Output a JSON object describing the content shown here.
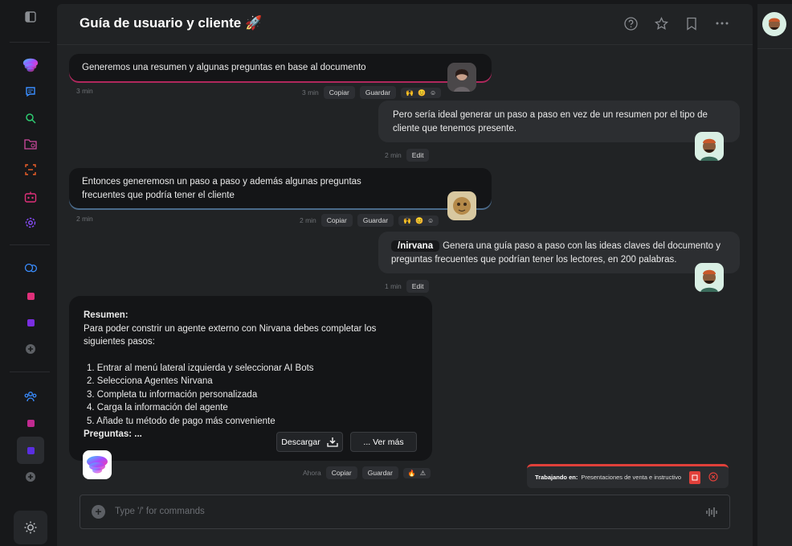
{
  "header": {
    "title": "Guía de usuario y cliente 🚀"
  },
  "messages": [
    {
      "text": "Generemos una resumen y algunas preguntas en base al documento",
      "time_left": "3 min",
      "time_right": "3 min",
      "copy": "Copiar",
      "save": "Guardar",
      "emojis": [
        "🙌",
        "😊",
        "☺"
      ]
    },
    {
      "text": "Pero sería ideal generar un paso a paso en vez de un resumen por el tipo de cliente que tenemos presente.",
      "time": "2 min",
      "edit": "Edit"
    },
    {
      "text": "Entonces generemosn un paso a paso y además algunas preguntas frecuentes  que podría tener el cliente",
      "time_left": "2 min",
      "time_right": "2 min",
      "copy": "Copiar",
      "save": "Guardar",
      "emojis": [
        "🙌",
        "😊",
        "☺"
      ]
    },
    {
      "command": "/nirvana",
      "text": "Genera una guía paso a paso con las ideas claves del documento y preguntas frecuentes que podrían tener los lectores, en 200 palabras.",
      "time": "1 min",
      "edit": "Edit"
    }
  ],
  "answer": {
    "heading": "Resumen:",
    "intro": "Para poder constrir un agente externo con Nirvana debes completar los siguientes pasos:",
    "steps": [
      "1. Entrar al menú lateral izquierda y seleccionar AI Bots",
      "2. Selecciona Agentes Nirvana",
      "3. Completa tu información personalizada",
      "4. Carga la información del agente",
      "5. Añade tu método de pago más conveniente"
    ],
    "faq": "Preguntas: ...",
    "download": "Descargar",
    "more": "...  Ver más",
    "time": "Ahora",
    "copy": "Copiar",
    "save": "Guardar",
    "emojis": [
      "🔥",
      "⚠"
    ]
  },
  "working": {
    "label": "Trabajando en:",
    "doc": "Presentaciones de venta e instructivo"
  },
  "composer": {
    "placeholder": "Type '/' for commands"
  },
  "colors": {
    "accent_pink": "#e0307a",
    "accent_purple": "#7a2ee0",
    "accent_green": "#2ecc71",
    "accent_orange": "#f0602a",
    "alert_red": "#e0403a"
  }
}
